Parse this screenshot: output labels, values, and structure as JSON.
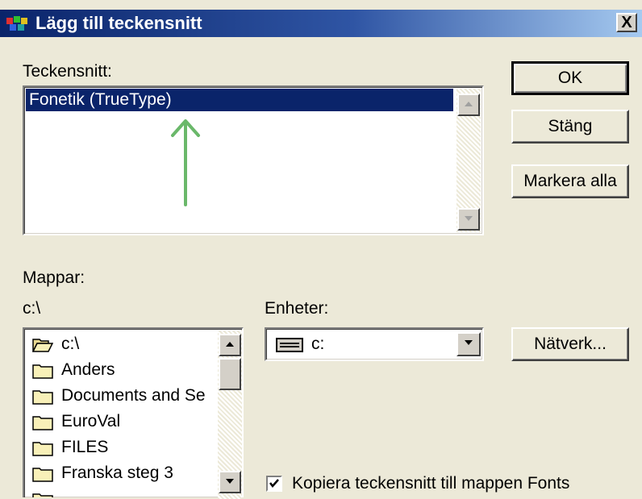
{
  "window": {
    "title": "Lägg till teckensnitt",
    "close_label": "X"
  },
  "fonts": {
    "label": "Teckensnitt:",
    "items": [
      "Fonetik (TrueType)"
    ]
  },
  "buttons": {
    "ok": "OK",
    "close": "Stäng",
    "select_all": "Markera alla",
    "network": "Nätverk..."
  },
  "folders": {
    "label": "Mappar:",
    "current_path": "c:\\",
    "items": [
      "c:\\",
      "Anders",
      "Documents and Se",
      "EuroVal",
      "FILES",
      "Franska steg 3"
    ]
  },
  "drives": {
    "label": "Enheter:",
    "selected": "c:"
  },
  "copy_option": {
    "label": "Kopiera teckensnitt till mappen Fonts",
    "checked": true
  },
  "colors": {
    "selection": "#0a246a",
    "arrow": "#6ab86a",
    "dialog_bg": "#ece9d8"
  }
}
